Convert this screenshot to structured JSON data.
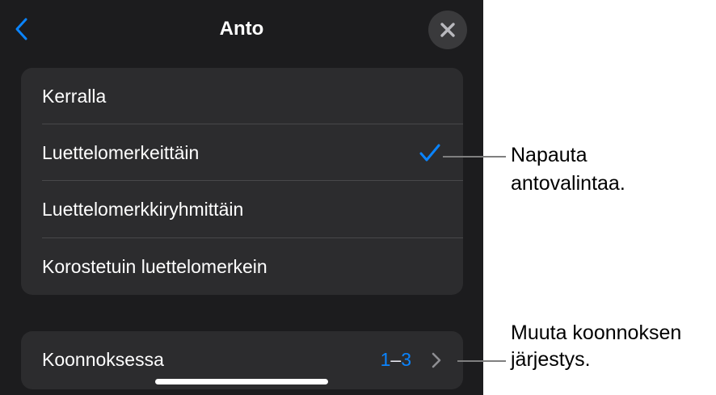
{
  "header": {
    "title": "Anto",
    "back_icon": "chevron-left-icon",
    "close_icon": "close-icon"
  },
  "options": {
    "items": [
      {
        "label": "Kerralla",
        "selected": false
      },
      {
        "label": "Luettelomerkeittäin",
        "selected": true
      },
      {
        "label": "Luettelomerkkiryhmittäin",
        "selected": false
      },
      {
        "label": "Korostetuin luettelomerkein",
        "selected": false
      }
    ],
    "check_icon": "checkmark-icon"
  },
  "order": {
    "label": "Koonnoksessa",
    "value_start": "1",
    "value_dash": "–",
    "value_end": "3",
    "chevron_icon": "chevron-right-icon"
  },
  "callouts": {
    "selection_line1": "Napauta",
    "selection_line2": "antovalintaa.",
    "order_line1": "Muuta koonnoksen",
    "order_line2": "järjestys."
  },
  "colors": {
    "accent": "#0a84ff",
    "panel_background": "#1c1c1e",
    "group_background": "#2c2c2e"
  }
}
